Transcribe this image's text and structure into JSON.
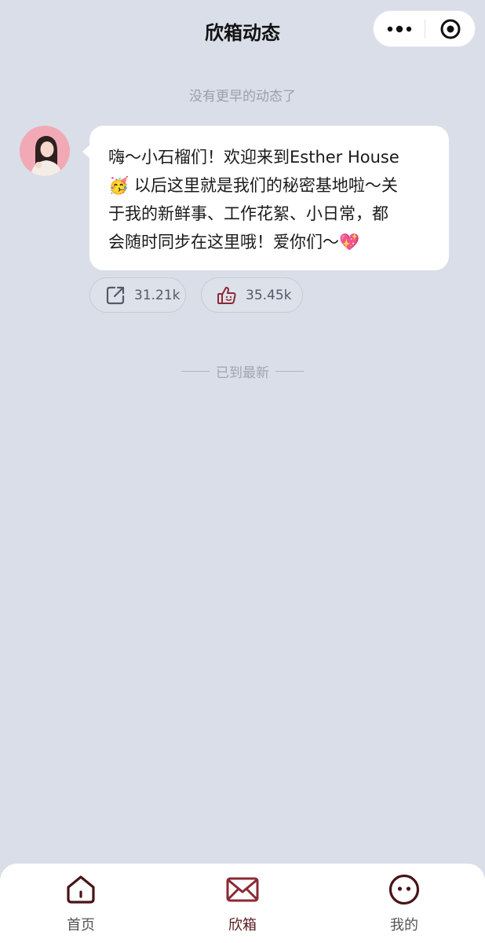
{
  "header": {
    "title": "欣箱动态"
  },
  "feed": {
    "no_earlier_text": "没有更早的动态了",
    "latest_text": "已到最新"
  },
  "post": {
    "lines": [
      "嗨～小石榴们！欢迎来到Esther House",
      "🥳 以后这里就是我们的秘密基地啦～关",
      "于我的新鲜事、工作花絮、小日常，都",
      "会随时同步在这里哦！爱你们～💖"
    ],
    "share_count": "31.21k",
    "like_count": "35.45k"
  },
  "tabbar": {
    "items": [
      {
        "label": "首页",
        "icon": "home-icon"
      },
      {
        "label": "欣箱",
        "icon": "mail-icon"
      },
      {
        "label": "我的",
        "icon": "profile-face-icon"
      }
    ]
  },
  "colors": {
    "background": "#d9dee8",
    "accent": "#8b2a33",
    "tab_icon_dark": "#4a1418"
  }
}
